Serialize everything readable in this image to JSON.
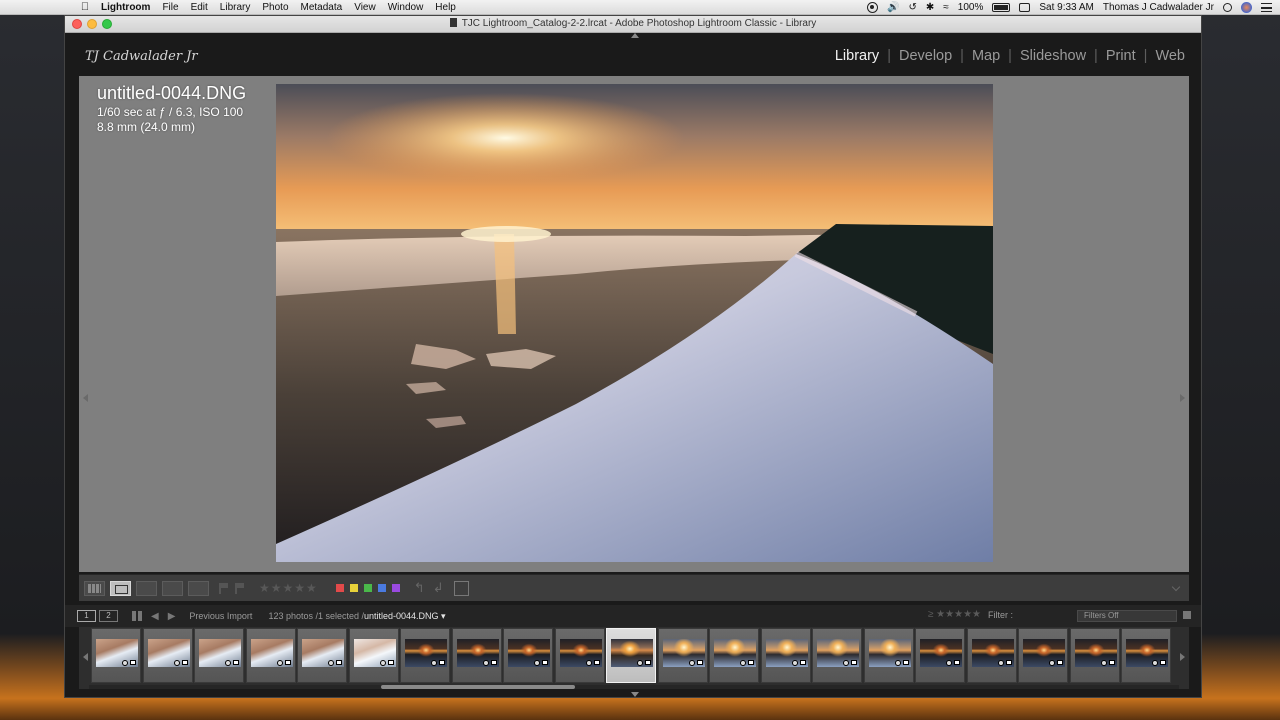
{
  "menubar": {
    "app_name": "Lightroom",
    "items": [
      "File",
      "Edit",
      "Library",
      "Photo",
      "Metadata",
      "View",
      "Window",
      "Help"
    ],
    "battery": "100%",
    "clock": "Sat 9:33 AM",
    "user": "Thomas J Cadwalader Jr"
  },
  "window": {
    "title": "TJC Lightroom_Catalog-2-2.lrcat - Adobe Photoshop Lightroom Classic - Library"
  },
  "identity_plate": "TJ Cadwalader Jr",
  "modules": {
    "items": [
      "Library",
      "Develop",
      "Map",
      "Slideshow",
      "Print",
      "Web"
    ],
    "active": "Library"
  },
  "loupe_info": {
    "filename": "untitled-0044.DNG",
    "exposure": "1/60 sec at ƒ / 6.3, ISO 100",
    "focal": "8.8 mm (24.0 mm)"
  },
  "toolbar": {
    "stars": "★★★★★",
    "swatches": [
      "#e24a4a",
      "#e8d23a",
      "#4ab84a",
      "#4a7ae0",
      "#9a4ae0"
    ],
    "rotate_left": "↰",
    "rotate_right": "↲"
  },
  "filmstrip_header": {
    "screen_1": "1",
    "screen_2": "2",
    "source": "Previous Import",
    "count": "123 photos /1 selected /",
    "current_file": "untitled-0044.DNG ▾",
    "filter_label": "Filter :",
    "filter_stars": "≥ ★★★★★",
    "filters_off": "Filters Off"
  },
  "filmstrip": {
    "thumbs": [
      "snow",
      "snow",
      "snow",
      "snow",
      "snow",
      "snow2",
      "dark",
      "dark",
      "dark",
      "dark",
      "sun",
      "sun2",
      "sun2",
      "sun2",
      "sun2",
      "sun2",
      "dark",
      "dark",
      "dark",
      "dark",
      "dark",
      "dark"
    ],
    "selected_index": 10
  },
  "colors": {
    "module_active": "#f2f2f2",
    "module_inactive": "#9a9a9a",
    "loupe_bg": "#7f7f7f"
  }
}
